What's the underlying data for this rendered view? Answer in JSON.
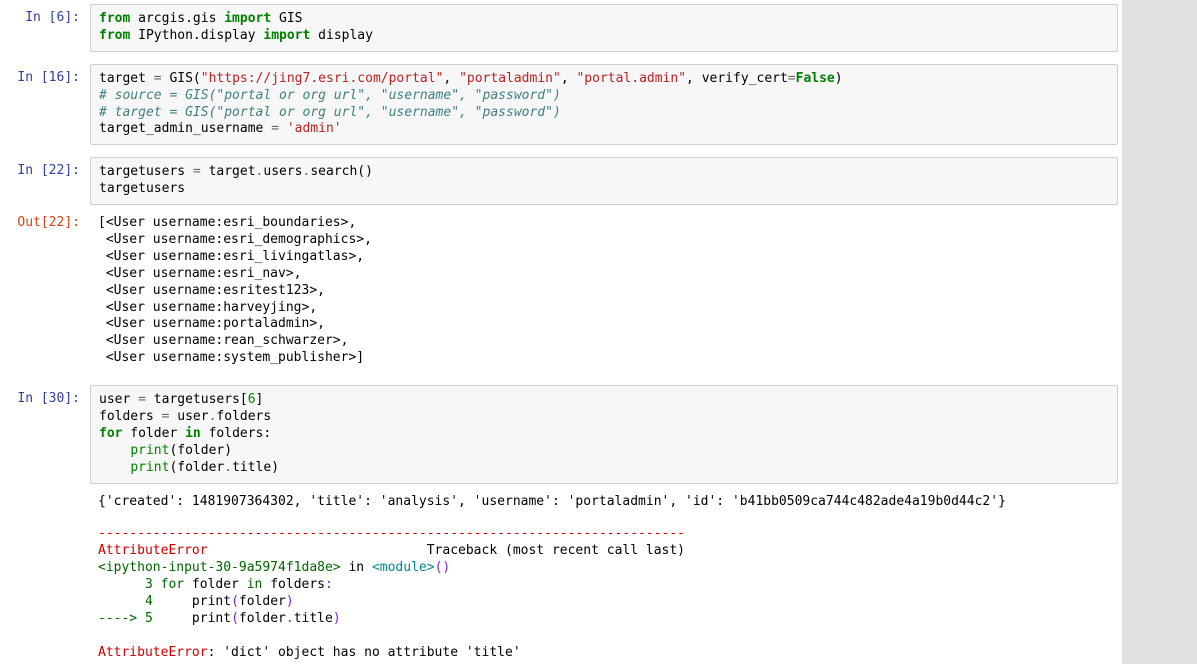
{
  "cells": [
    {
      "kind": "code",
      "prompt_in": "In [6]:",
      "code_html": "<span class=\"kw\">from</span> arcgis.gis <span class=\"kw\">import</span> GIS\n<span class=\"kw\">from</span> IPython.display <span class=\"kw\">import</span> display"
    },
    {
      "kind": "code",
      "prompt_in": "In [16]:",
      "code_html": "target <span class=\"op\">=</span> GIS(<span class=\"s\">\"https://jing7.esri.com/portal\"</span>, <span class=\"s\">\"portaladmin\"</span>, <span class=\"s\">\"portal.admin\"</span>, verify_cert<span class=\"op\">=</span><span class=\"bl\">False</span>)\n<span class=\"cm\"># source = GIS(\"portal or org url\", \"username\", \"password\")</span>\n<span class=\"cm\"># target = GIS(\"portal or org url\", \"username\", \"password\")</span>\ntarget_admin_username <span class=\"op\">=</span> <span class=\"s\">'admin'</span>"
    },
    {
      "kind": "code",
      "prompt_in": "In [22]:",
      "code_html": "targetusers <span class=\"op\">=</span> target<span class=\"op\">.</span>users<span class=\"op\">.</span>search()\ntargetusers"
    },
    {
      "kind": "output",
      "prompt_out": "Out[22]:",
      "text": "[<User username:esri_boundaries>,\n <User username:esri_demographics>,\n <User username:esri_livingatlas>,\n <User username:esri_nav>,\n <User username:esritest123>,\n <User username:harveyjing>,\n <User username:portaladmin>,\n <User username:rean_schwarzer>,\n <User username:system_publisher>]"
    },
    {
      "kind": "code",
      "prompt_in": "In [30]:",
      "code_html": "user <span class=\"op\">=</span> targetusers[<span class=\"nb\">6</span>]\nfolders <span class=\"op\">=</span> user<span class=\"op\">.</span>folders\n<span class=\"kw\">for</span> folder <span class=\"kw\">in</span> folders:\n    <span class=\"nb\">print</span>(folder)\n    <span class=\"nb\">print</span>(folder<span class=\"op\">.</span>title)"
    },
    {
      "kind": "stdout",
      "text": "{'created': 1481907364302, 'title': 'analysis', 'username': 'portaladmin', 'id': 'b41bb0509ca744c482ade4a19b0d44c2'}"
    },
    {
      "kind": "traceback",
      "html": "<span class=\"tb-red\">---------------------------------------------------------------------------</span>\n<span class=\"tb-red\">AttributeError</span>                            Traceback (most recent call last)\n<span class=\"tb-green\">&lt;ipython-input-30-9a5974f1da8e&gt;</span> in <span class=\"tb-cyan\">&lt;module&gt;</span><span class=\"tb-purple\">()</span>\n<span class=\"tb-green\">      3</span> <span class=\"tb-green\">for</span> folder <span class=\"tb-green\">in</span> folders<span class=\"tb-purple\">:</span>\n<span class=\"tb-green\">      4</span>     print<span class=\"tb-purple\">(</span>folder<span class=\"tb-purple\">)</span>\n<span class=\"tb-green\">----&gt; 5</span>     print<span class=\"tb-purple\">(</span>folder<span class=\"tb-purple\">.</span>title<span class=\"tb-purple\">)</span>\n\n<span class=\"tb-red\">AttributeError</span>: 'dict' object has no attribute 'title'"
    }
  ]
}
